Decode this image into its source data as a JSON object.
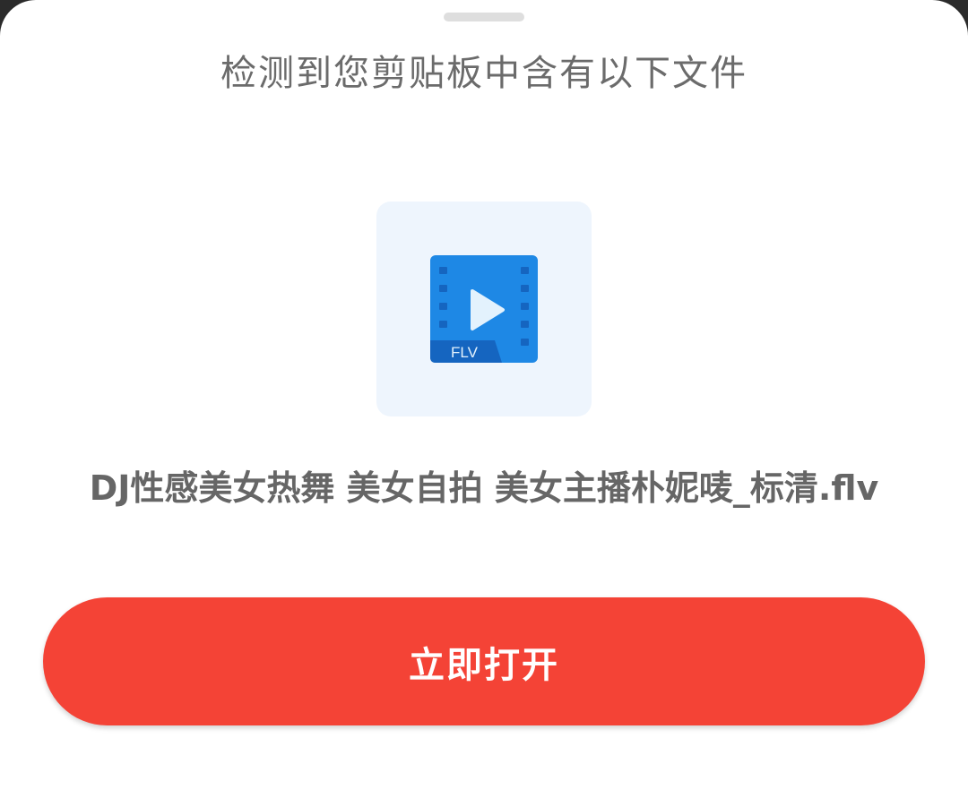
{
  "sheet": {
    "title": "检测到您剪贴板中含有以下文件"
  },
  "file": {
    "icon": "flv-video-file-icon",
    "badge": "FLV",
    "name": "DJ性感美女热舞 美女自拍 美女主播朴妮唛_标清.flv"
  },
  "actions": {
    "open_label": "立即打开"
  },
  "colors": {
    "accent": "#f44336",
    "icon_blue": "#1e88e5",
    "card_bg": "#eef5fd"
  }
}
